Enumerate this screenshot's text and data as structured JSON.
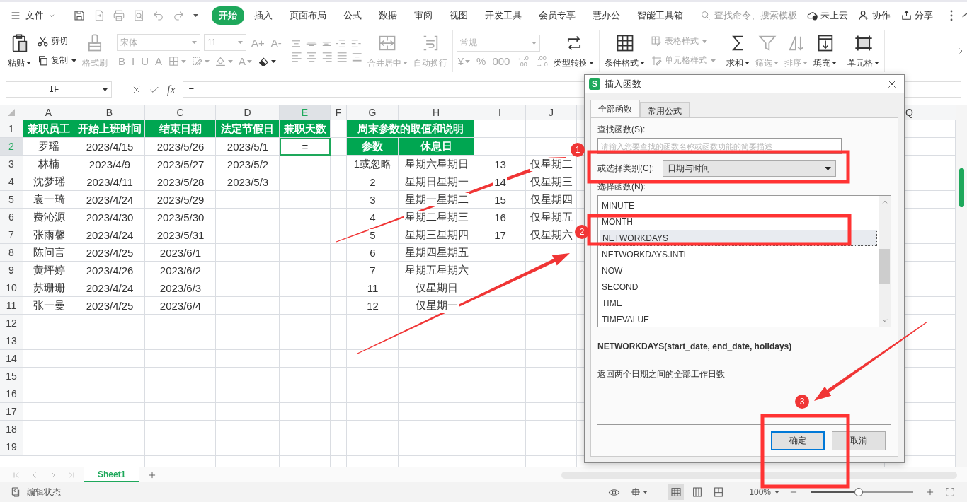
{
  "menu_bar": {
    "file_menu": "文件",
    "tabs": [
      {
        "label": "开始",
        "selected": true
      },
      {
        "label": "插入",
        "selected": false
      },
      {
        "label": "页面布局",
        "selected": false
      },
      {
        "label": "公式",
        "selected": false
      },
      {
        "label": "数据",
        "selected": false
      },
      {
        "label": "审阅",
        "selected": false
      },
      {
        "label": "视图",
        "selected": false
      },
      {
        "label": "开发工具",
        "selected": false
      },
      {
        "label": "会员专享",
        "selected": false
      },
      {
        "label": "慧办公",
        "selected": false
      },
      {
        "label": "智能工具箱",
        "selected": false
      }
    ],
    "search": {
      "placeholder": "查找命令、搜索模板"
    },
    "actions": [
      "未上云",
      "协作",
      "分享"
    ]
  },
  "ribbon": {
    "groups": [
      {
        "items": [
          {
            "kind": "large",
            "label": "粘贴",
            "dropdown": true,
            "disabled": false
          },
          {
            "kind": "stack",
            "items": [
              {
                "kind": "small",
                "label": "剪切",
                "disabled": false
              },
              {
                "kind": "small",
                "label": "复制",
                "dropdown": true,
                "disabled": false
              }
            ]
          },
          {
            "kind": "large",
            "label": "格式刷",
            "disabled": true
          }
        ]
      },
      {
        "items": [
          {
            "kind": "panel",
            "top": [
              {
                "kind": "combo",
                "value": "宋体",
                "disabled": true
              },
              {
                "kind": "spin",
                "value": "11",
                "disabled": true
              },
              {
                "kind": "glyph",
                "label": "A+",
                "disabled": true
              },
              {
                "kind": "glyph",
                "label": "A-",
                "disabled": true
              }
            ],
            "bottom": [
              {
                "kind": "glyph",
                "label": "B",
                "disabled": true
              },
              {
                "kind": "glyph",
                "label": "I",
                "disabled": true
              },
              {
                "kind": "glyph",
                "label": "U",
                "disabled": true
              },
              {
                "kind": "glyph",
                "label": "A",
                "disabled": true
              },
              {
                "kind": "icon",
                "dropdown": true,
                "disabled": true
              },
              {
                "kind": "icon",
                "dropdown": true,
                "disabled": true
              },
              {
                "kind": "icon",
                "dropdown": true,
                "disabled": true
              },
              {
                "kind": "glyph",
                "label": "A",
                "dropdown": true,
                "disabled": true
              },
              {
                "kind": "icon",
                "dropdown": true,
                "disabled": false
              }
            ]
          }
        ]
      },
      {
        "items": [
          {
            "kind": "panel",
            "top": [
              {
                "kind": "icon",
                "disabled": true
              },
              {
                "kind": "icon",
                "disabled": true
              },
              {
                "kind": "icon",
                "disabled": true
              },
              {
                "kind": "icon",
                "disabled": true
              },
              {
                "kind": "icon",
                "disabled": true
              }
            ],
            "bottom": [
              {
                "kind": "icon",
                "disabled": true
              },
              {
                "kind": "icon",
                "disabled": true
              },
              {
                "kind": "icon",
                "disabled": true
              },
              {
                "kind": "icon",
                "disabled": true
              },
              {
                "kind": "icon",
                "disabled": true
              }
            ]
          },
          {
            "kind": "large",
            "label": "合并居中",
            "dropdown": true,
            "disabled": true
          },
          {
            "kind": "large",
            "label": "自动换行",
            "disabled": true
          }
        ]
      },
      {
        "items": [
          {
            "kind": "panel",
            "top": [
              {
                "kind": "combo",
                "value": "常规",
                "disabled": true
              }
            ],
            "bottom": [
              {
                "kind": "glyph",
                "label": "¥",
                "dropdown": true,
                "disabled": true
              },
              {
                "kind": "glyph",
                "label": "%",
                "disabled": true
              },
              {
                "kind": "glyph",
                "label": "000",
                "disabled": true
              },
              {
                "kind": "glyph",
                "label": "←.0 .00",
                "disabled": true
              },
              {
                "kind": "glyph",
                "label": ".00 →.0",
                "disabled": true
              }
            ]
          },
          {
            "kind": "large",
            "label": "类型转换",
            "dropdown": true,
            "disabled": false
          }
        ]
      },
      {
        "items": [
          {
            "kind": "large",
            "label": "条件格式",
            "dropdown": true,
            "disabled": false
          },
          {
            "kind": "stack",
            "items": [
              {
                "kind": "small",
                "label": "表格样式",
                "dropdown": true,
                "disabled": true
              },
              {
                "kind": "small",
                "label": "单元格样式",
                "dropdown": true,
                "disabled": true
              }
            ]
          }
        ]
      },
      {
        "items": [
          {
            "kind": "large",
            "label": "求和",
            "dropdown": true,
            "disabled": false
          },
          {
            "kind": "large",
            "label": "筛选",
            "dropdown": true,
            "disabled": true
          },
          {
            "kind": "large",
            "label": "排序",
            "dropdown": true,
            "disabled": true
          },
          {
            "kind": "large",
            "label": "填充",
            "dropdown": true,
            "disabled": false
          }
        ]
      },
      {
        "items": [
          {
            "kind": "large",
            "label": "单元格",
            "dropdown": true,
            "disabled": false
          }
        ]
      }
    ]
  },
  "formula_bar": {
    "name_box": "IF",
    "function_label": "fx",
    "formula": "="
  },
  "sheet": {
    "columns": [
      {
        "letter": "A",
        "selected": false
      },
      {
        "letter": "B",
        "selected": false
      },
      {
        "letter": "C",
        "selected": false
      },
      {
        "letter": "D",
        "selected": false
      },
      {
        "letter": "E",
        "selected": true
      },
      {
        "letter": "F",
        "selected": false
      },
      {
        "letter": "G",
        "selected": false
      },
      {
        "letter": "H",
        "selected": false
      },
      {
        "letter": "I",
        "selected": false
      },
      {
        "letter": "J",
        "selected": false
      },
      {
        "letter": "Q",
        "selected": false
      }
    ],
    "rows": [
      {
        "number": "1",
        "selected": false,
        "cells": [
          {
            "text": "兼职员工",
            "kind": "header"
          },
          {
            "text": "开始上班时间",
            "kind": "header"
          },
          {
            "text": "结束日期",
            "kind": "header"
          },
          {
            "text": "法定节假日",
            "kind": "header"
          },
          {
            "text": "兼职天数",
            "kind": "header"
          },
          {
            "kind": "empty"
          },
          {
            "text": "周末参数的取值和说明",
            "kind": "wide"
          }
        ]
      },
      {
        "number": "2",
        "selected": true,
        "cells": [
          {
            "text": "罗瑶",
            "kind": "value"
          },
          {
            "text": "2023/4/15",
            "kind": "value"
          },
          {
            "text": "2023/5/26",
            "kind": "value"
          },
          {
            "text": "2023/5/1",
            "kind": "value"
          },
          {
            "text": "=",
            "kind": "active"
          },
          {
            "kind": "empty"
          },
          {
            "text": "参数",
            "kind": "header"
          },
          {
            "text": "休息日",
            "kind": "header"
          }
        ]
      },
      {
        "number": "3",
        "selected": false,
        "cells": [
          {
            "text": "林楠",
            "kind": "value"
          },
          {
            "text": "2023/4/9",
            "kind": "value"
          },
          {
            "text": "2023/5/27",
            "kind": "value"
          },
          {
            "text": "2023/5/2",
            "kind": "value"
          },
          {
            "kind": "empty"
          },
          {
            "kind": "empty"
          },
          {
            "text": "1或忽略",
            "kind": "value"
          },
          {
            "text": "星期六星期日",
            "kind": "value"
          },
          {
            "text": "13",
            "kind": "value"
          },
          {
            "text": "仅星期二",
            "kind": "value"
          }
        ]
      },
      {
        "number": "4",
        "selected": false,
        "cells": [
          {
            "text": "沈梦瑶",
            "kind": "value"
          },
          {
            "text": "2023/4/11",
            "kind": "value"
          },
          {
            "text": "2023/5/28",
            "kind": "value"
          },
          {
            "text": "2023/5/3",
            "kind": "value"
          },
          {
            "kind": "empty"
          },
          {
            "kind": "empty"
          },
          {
            "text": "2",
            "kind": "value"
          },
          {
            "text": "星期日星期一",
            "kind": "value"
          },
          {
            "text": "14",
            "kind": "value"
          },
          {
            "text": "仅星期三",
            "kind": "value"
          }
        ]
      },
      {
        "number": "5",
        "selected": false,
        "cells": [
          {
            "text": "袁一琦",
            "kind": "value"
          },
          {
            "text": "2023/4/24",
            "kind": "value"
          },
          {
            "text": "2023/5/29",
            "kind": "value"
          },
          {
            "kind": "empty"
          },
          {
            "kind": "empty"
          },
          {
            "kind": "empty"
          },
          {
            "text": "3",
            "kind": "value"
          },
          {
            "text": "星期一星期二",
            "kind": "value"
          },
          {
            "text": "15",
            "kind": "value"
          },
          {
            "text": "仅星期四",
            "kind": "value"
          }
        ]
      },
      {
        "number": "6",
        "selected": false,
        "cells": [
          {
            "text": "费沁源",
            "kind": "value"
          },
          {
            "text": "2023/4/30",
            "kind": "value"
          },
          {
            "text": "2023/5/30",
            "kind": "value"
          },
          {
            "kind": "empty"
          },
          {
            "kind": "empty"
          },
          {
            "kind": "empty"
          },
          {
            "text": "4",
            "kind": "value"
          },
          {
            "text": "星期二星期三",
            "kind": "value"
          },
          {
            "text": "16",
            "kind": "value"
          },
          {
            "text": "仅星期五",
            "kind": "value"
          }
        ]
      },
      {
        "number": "7",
        "selected": false,
        "cells": [
          {
            "text": "张雨馨",
            "kind": "value"
          },
          {
            "text": "2023/4/24",
            "kind": "value"
          },
          {
            "text": "2023/5/31",
            "kind": "value"
          },
          {
            "kind": "empty"
          },
          {
            "kind": "empty"
          },
          {
            "kind": "empty"
          },
          {
            "text": "5",
            "kind": "value"
          },
          {
            "text": "星期三星期四",
            "kind": "value"
          },
          {
            "text": "17",
            "kind": "value"
          },
          {
            "text": "仅星期六",
            "kind": "value"
          }
        ]
      },
      {
        "number": "8",
        "selected": false,
        "cells": [
          {
            "text": "陈问言",
            "kind": "value"
          },
          {
            "text": "2023/4/25",
            "kind": "value"
          },
          {
            "text": "2023/6/1",
            "kind": "value"
          },
          {
            "kind": "empty"
          },
          {
            "kind": "empty"
          },
          {
            "kind": "empty"
          },
          {
            "text": "6",
            "kind": "value"
          },
          {
            "text": "星期四星期五",
            "kind": "value"
          }
        ]
      },
      {
        "number": "9",
        "selected": false,
        "cells": [
          {
            "text": "黄坪婷",
            "kind": "value"
          },
          {
            "text": "2023/4/26",
            "kind": "value"
          },
          {
            "text": "2023/6/2",
            "kind": "value"
          },
          {
            "kind": "empty"
          },
          {
            "kind": "empty"
          },
          {
            "kind": "empty"
          },
          {
            "text": "7",
            "kind": "value"
          },
          {
            "text": "星期五星期六",
            "kind": "value"
          }
        ]
      },
      {
        "number": "10",
        "selected": false,
        "cells": [
          {
            "text": "苏珊珊",
            "kind": "value"
          },
          {
            "text": "2023/4/24",
            "kind": "value"
          },
          {
            "text": "2023/6/3",
            "kind": "value"
          },
          {
            "kind": "empty"
          },
          {
            "kind": "empty"
          },
          {
            "kind": "empty"
          },
          {
            "text": "11",
            "kind": "value"
          },
          {
            "text": "仅星期日",
            "kind": "value"
          }
        ]
      },
      {
        "number": "11",
        "selected": false,
        "cells": [
          {
            "text": "张一曼",
            "kind": "value"
          },
          {
            "text": "2023/4/25",
            "kind": "value"
          },
          {
            "text": "2023/6/4",
            "kind": "value"
          },
          {
            "kind": "empty"
          },
          {
            "kind": "empty"
          },
          {
            "kind": "empty"
          },
          {
            "text": "12",
            "kind": "value"
          },
          {
            "text": "仅星期一",
            "kind": "value"
          }
        ]
      },
      {
        "number": "12",
        "selected": false,
        "cells": []
      },
      {
        "number": "13",
        "selected": false,
        "cells": []
      },
      {
        "number": "14",
        "selected": false,
        "cells": []
      },
      {
        "number": "15",
        "selected": false,
        "cells": []
      },
      {
        "number": "16",
        "selected": false,
        "cells": []
      },
      {
        "number": "17",
        "selected": false,
        "cells": []
      },
      {
        "number": "18",
        "selected": false,
        "cells": []
      },
      {
        "number": "19",
        "selected": false,
        "cells": []
      }
    ]
  },
  "dialog": {
    "logo": "S",
    "title": "插入函数",
    "tabs": [
      {
        "label": "全部函数",
        "selected": true
      },
      {
        "label": "常用公式",
        "selected": false
      }
    ],
    "search_label": "查找函数(S):",
    "search_placeholder": "请输入您要查找的函数名称或函数功能的简要描述",
    "category_label": "或选择类别(C):",
    "category": "日期与时间",
    "list_label": "选择函数(N):",
    "functions": [
      {
        "name": "MINUTE",
        "selected": false
      },
      {
        "name": "MONTH",
        "selected": false
      },
      {
        "name": "NETWORKDAYS",
        "selected": true
      },
      {
        "name": "NETWORKDAYS.INTL",
        "selected": false
      },
      {
        "name": "NOW",
        "selected": false
      },
      {
        "name": "SECOND",
        "selected": false
      },
      {
        "name": "TIME",
        "selected": false
      },
      {
        "name": "TIMEVALUE",
        "selected": false
      }
    ],
    "signature": "NETWORKDAYS(start_date, end_date, holidays)",
    "description": "返回两个日期之间的全部工作日数",
    "buttons": [
      {
        "label": "确定",
        "default": true
      },
      {
        "label": "取消",
        "default": false
      }
    ]
  },
  "annotations": {
    "steps": [
      "1",
      "2",
      "3"
    ]
  },
  "sheet_tabs": [
    {
      "label": "Sheet1",
      "selected": true
    }
  ],
  "status_bar": {
    "mode": "编辑状态",
    "views": [
      {
        "selected": true
      },
      {
        "selected": false
      },
      {
        "selected": false
      }
    ],
    "zoom": "100%",
    "level": 0.47
  }
}
